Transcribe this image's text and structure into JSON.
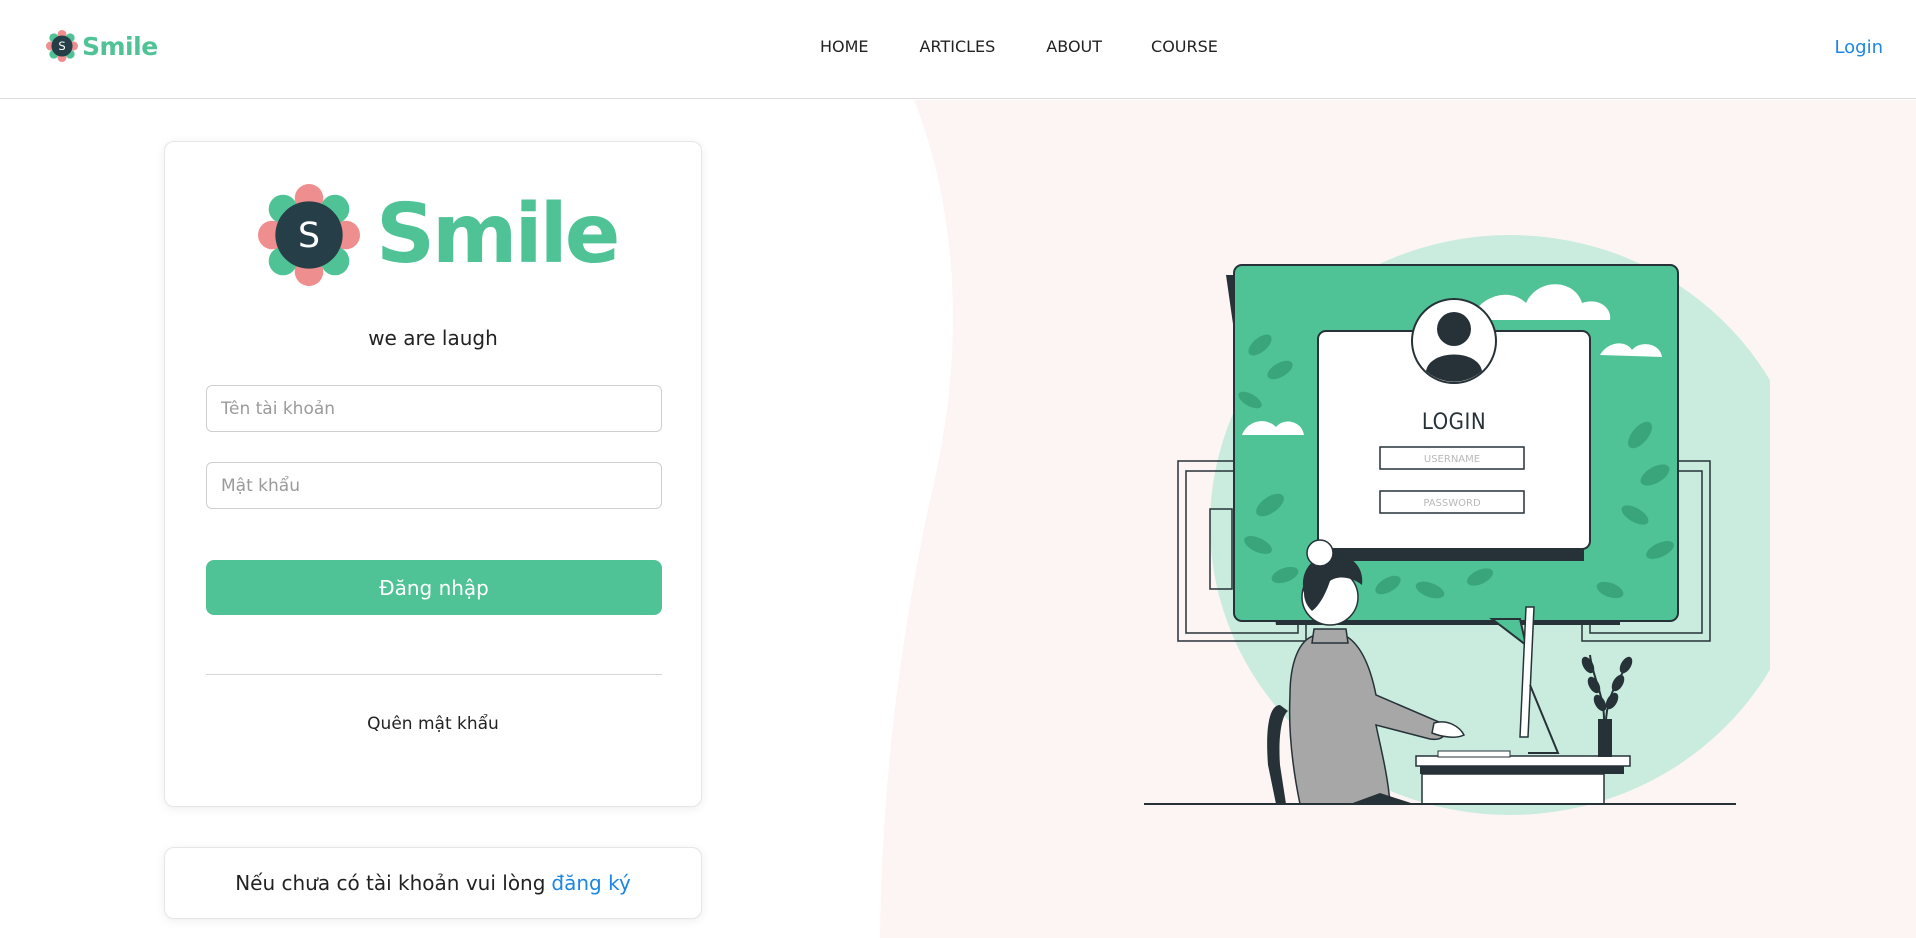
{
  "header": {
    "brand": "Smile",
    "nav": [
      "HOME",
      "ARTICLES",
      "ABOUT",
      "COURSE"
    ],
    "login_link": "Login"
  },
  "login_card": {
    "brand": "Smile",
    "logo_letter": "S",
    "tagline": "we are laugh",
    "username_placeholder": "Tên tài khoản",
    "password_placeholder": "Mật khẩu",
    "submit_label": "Đăng nhập",
    "forgot_label": "Quên mật khẩu"
  },
  "register_card": {
    "text": "Nếu chưa có tài khoản vui lòng",
    "link_label": "đăng ký"
  },
  "illustration": {
    "title": "LOGIN",
    "username_label": "USERNAME",
    "password_label": "PASSWORD"
  },
  "colors": {
    "brand_green": "#4fc396",
    "link_blue": "#1b86e3",
    "logo_dark": "#263e47",
    "logo_pink": "#ef8e8e",
    "background_pink": "#fdf4f4",
    "illustration_mint": "#c9ecde"
  },
  "icons": [
    "smile-logo-icon",
    "user-avatar-icon"
  ]
}
